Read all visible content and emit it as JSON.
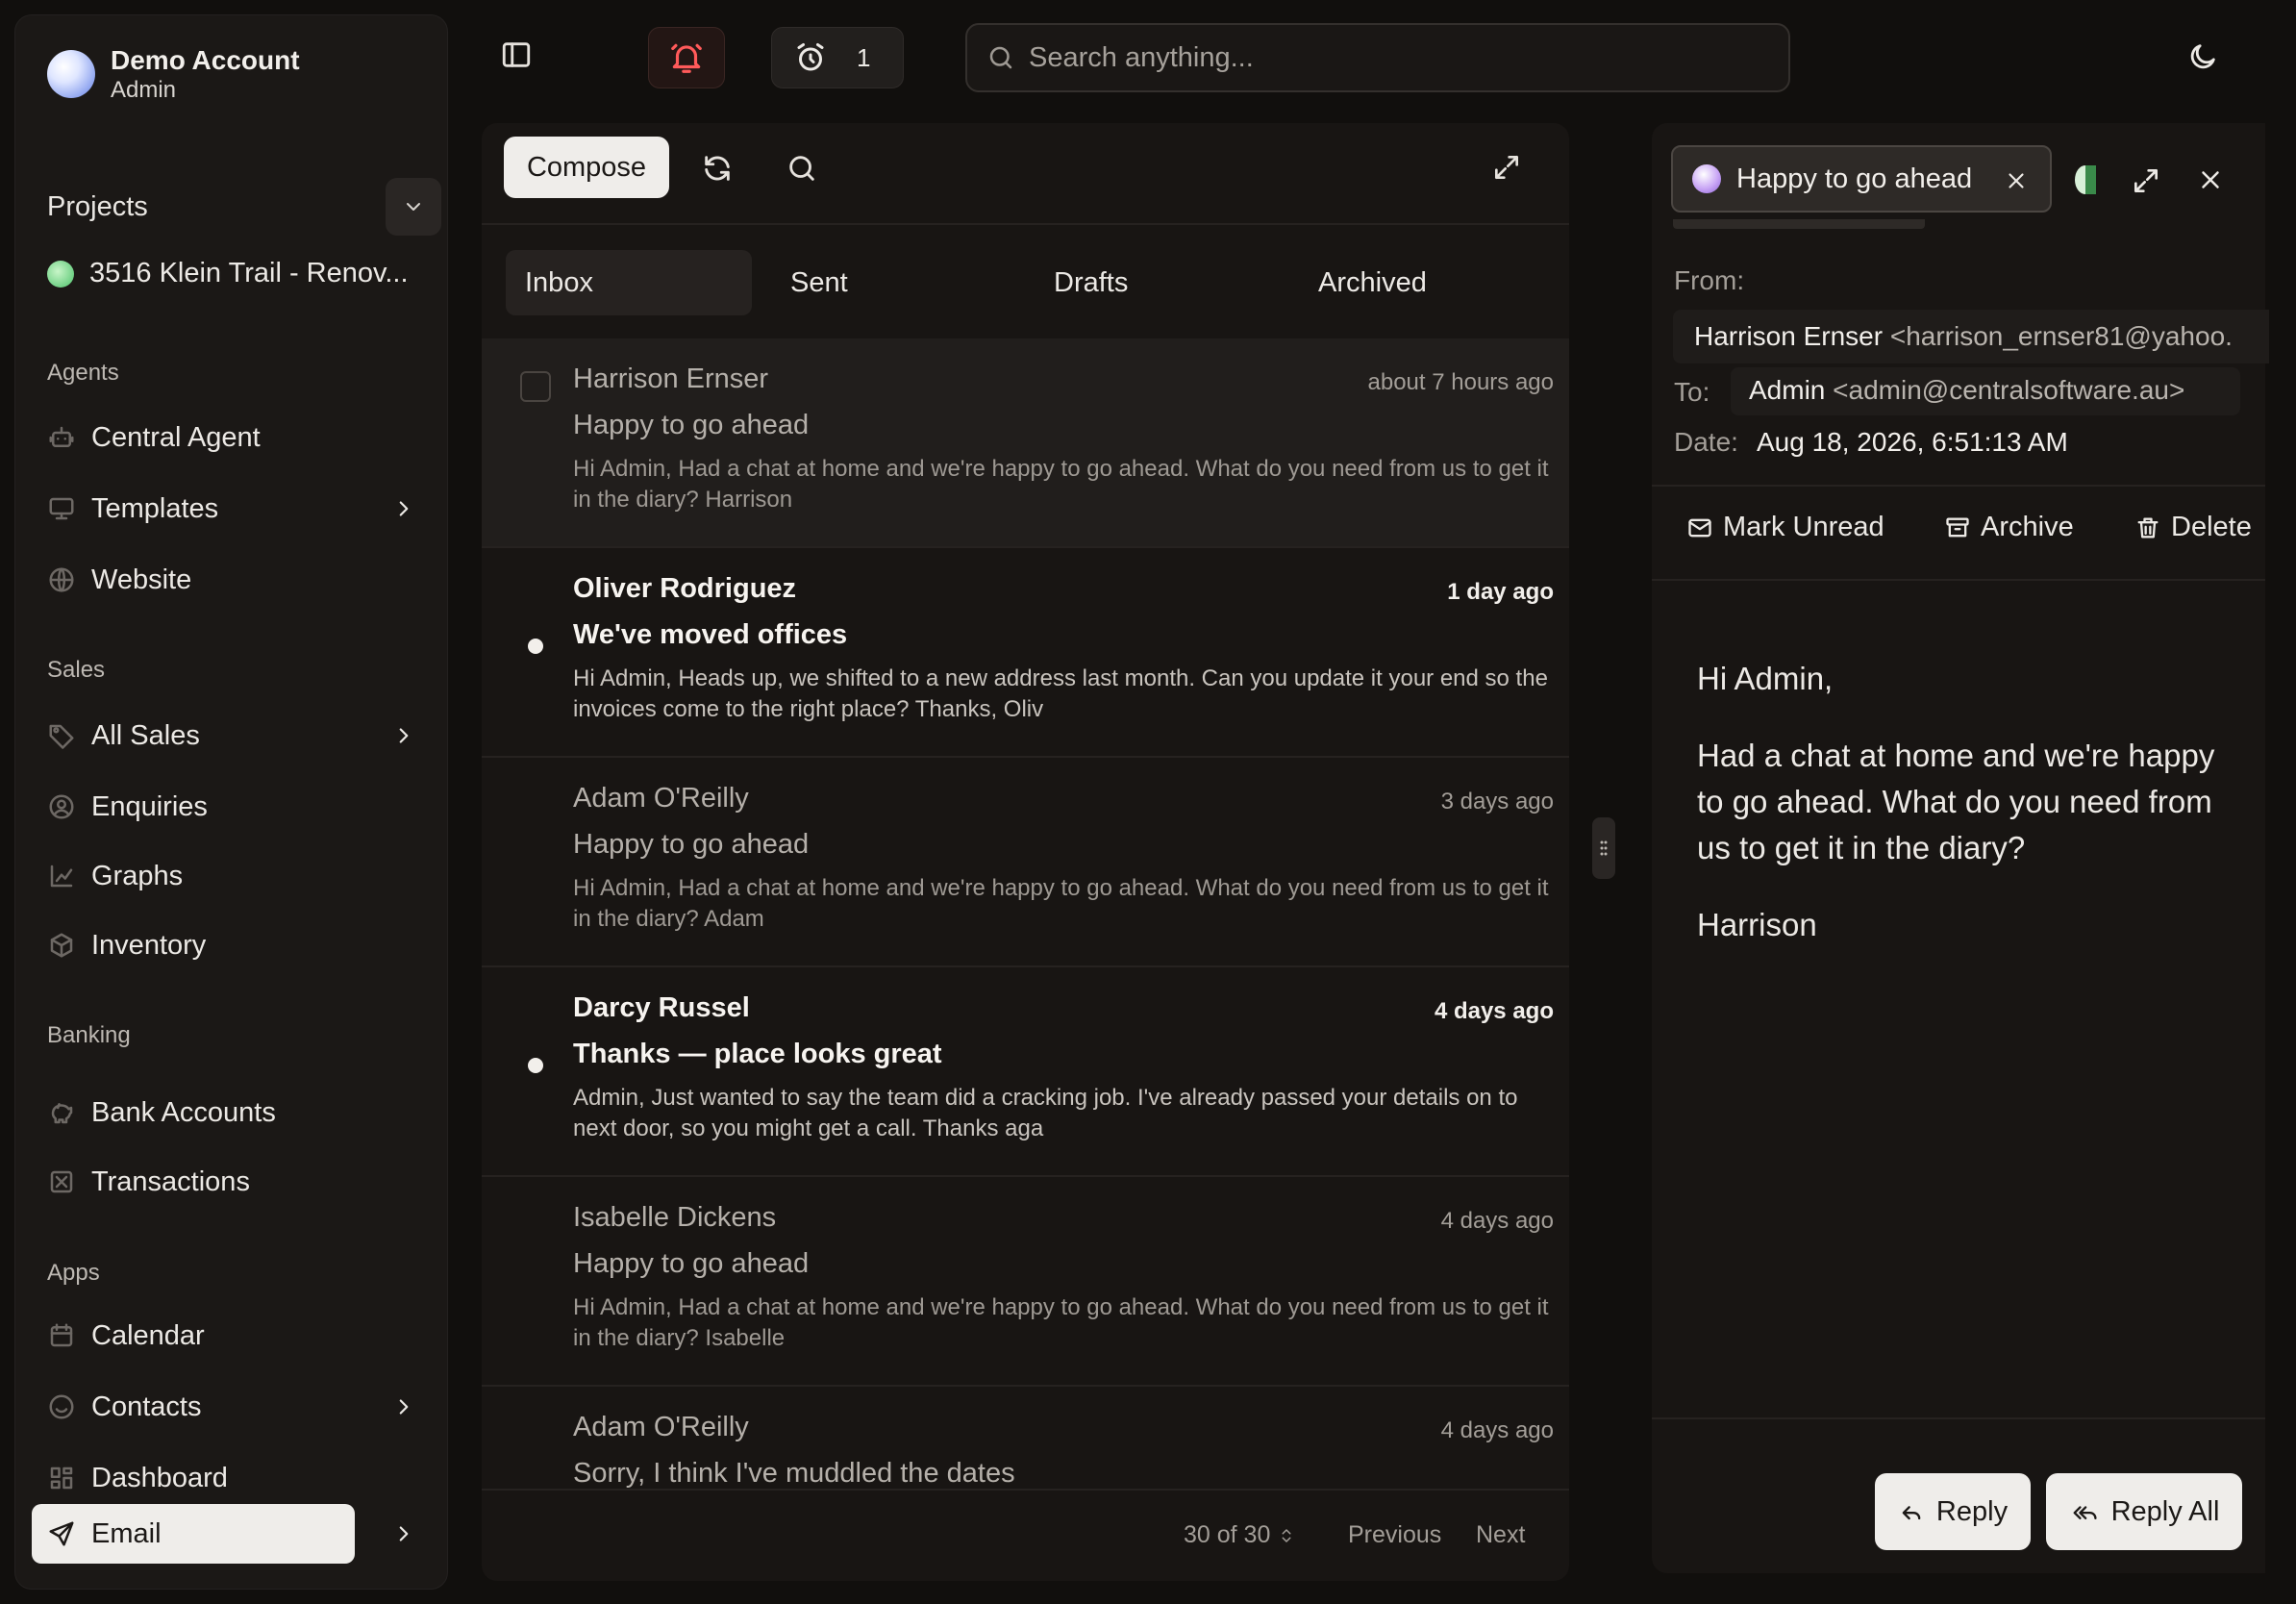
{
  "account": {
    "name": "Demo Account",
    "role": "Admin"
  },
  "projects": {
    "label": "Projects",
    "current": "3516 Klein Trail - Renov..."
  },
  "nav": {
    "agents": {
      "title": "Agents",
      "items": [
        {
          "label": "Central Agent",
          "icon": "robot-icon"
        },
        {
          "label": "Templates",
          "icon": "monitor-icon"
        },
        {
          "label": "Website",
          "icon": "globe-icon"
        }
      ]
    },
    "sales": {
      "title": "Sales",
      "items": [
        {
          "label": "All Sales",
          "icon": "tag-icon"
        },
        {
          "label": "Enquiries",
          "icon": "user-circle-icon"
        },
        {
          "label": "Graphs",
          "icon": "chart-icon"
        },
        {
          "label": "Inventory",
          "icon": "box-icon"
        }
      ]
    },
    "banking": {
      "title": "Banking",
      "items": [
        {
          "label": "Bank Accounts",
          "icon": "piggy-bank-icon"
        },
        {
          "label": "Transactions",
          "icon": "receipt-icon"
        }
      ]
    },
    "apps": {
      "title": "Apps",
      "items": [
        {
          "label": "Calendar",
          "icon": "calendar-icon"
        },
        {
          "label": "Contacts",
          "icon": "contacts-icon"
        },
        {
          "label": "Dashboard",
          "icon": "grid-icon"
        },
        {
          "label": "Email",
          "icon": "send-icon"
        }
      ]
    }
  },
  "topbar": {
    "alarm_count": "1",
    "search_placeholder": "Search anything..."
  },
  "list": {
    "compose_label": "Compose",
    "tabs": [
      "Inbox",
      "Sent",
      "Drafts",
      "Archived"
    ],
    "emails": [
      {
        "from": "Harrison Ernser",
        "time": "about 7 hours ago",
        "subject": "Happy to go ahead",
        "preview": "Hi Admin, Had a chat at home and we're happy to go ahead. What do you need from us to get it in the diary? Harrison",
        "unread": false,
        "selected": true
      },
      {
        "from": "Oliver Rodriguez",
        "time": "1 day ago",
        "subject": "We've moved offices",
        "preview": "Hi Admin, Heads up, we shifted to a new address last month. Can you update it your end so the invoices come to the right place? Thanks, Oliv",
        "unread": true,
        "selected": false
      },
      {
        "from": "Adam O'Reilly",
        "time": "3 days ago",
        "subject": "Happy to go ahead",
        "preview": "Hi Admin, Had a chat at home and we're happy to go ahead. What do you need from us to get it in the diary? Adam",
        "unread": false,
        "selected": false
      },
      {
        "from": "Darcy Russel",
        "time": "4 days ago",
        "subject": "Thanks — place looks great",
        "preview": "Admin, Just wanted to say the team did a cracking job. I've already passed your details on to next door, so you might get a call. Thanks aga",
        "unread": true,
        "selected": false
      },
      {
        "from": "Isabelle Dickens",
        "time": "4 days ago",
        "subject": "Happy to go ahead",
        "preview": "Hi Admin, Had a chat at home and we're happy to go ahead. What do you need from us to get it in the diary? Isabelle",
        "unread": false,
        "selected": false
      },
      {
        "from": "Adam O'Reilly",
        "time": "4 days ago",
        "subject": "Sorry, I think I've muddled the dates",
        "preview": "",
        "unread": false,
        "selected": false
      }
    ],
    "pagination": {
      "count": "30 of 30",
      "previous": "Previous",
      "next": "Next"
    }
  },
  "reader": {
    "tab_label": "Happy to go ahead",
    "from_label": "From:",
    "from_name": "Harrison Ernser",
    "from_email": "<harrison_ernser81@yahoo.",
    "to_label": "To:",
    "to_name": "Admin",
    "to_email": "<admin@centralsoftware.au>",
    "date_label": "Date:",
    "date_value": "Aug 18, 2026, 6:51:13 AM",
    "actions": {
      "mark_unread": "Mark Unread",
      "archive": "Archive",
      "delete": "Delete"
    },
    "body": [
      "Hi Admin,",
      "Had a chat at home and we're happy to go ahead. What do you need from us to get it in the diary?",
      "Harrison"
    ],
    "reply_label": "Reply",
    "reply_all_label": "Reply All"
  }
}
